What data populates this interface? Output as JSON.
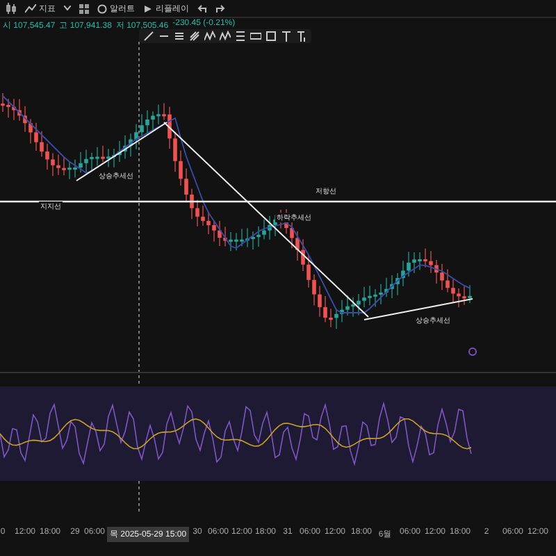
{
  "toolbar": {
    "items": [
      {
        "kind": "indicator",
        "label": "지표"
      },
      {
        "kind": "alert",
        "label": "알러트"
      },
      {
        "kind": "replay",
        "label": "리플레이"
      }
    ]
  },
  "ohlc": [
    {
      "label": "시",
      "value": "107,545.47"
    },
    {
      "label": "고",
      "value": "107,941.38"
    },
    {
      "label": "저",
      "value": "107,505.46"
    },
    {
      "value": "-230.45 (-0.21%)"
    }
  ],
  "annotations": [
    {
      "text": "지지선"
    },
    {
      "text": "상승추세선"
    },
    {
      "text": "하락추세선"
    },
    {
      "text": "저항선"
    },
    {
      "text": "상승추세선"
    }
  ],
  "time_axis": {
    "labels": [
      "0",
      "12:00",
      "18:00",
      "29",
      "06:00",
      "30",
      "06:00",
      "12:00",
      "18:00",
      "31",
      "06:00",
      "12:00",
      "18:00",
      "6월",
      "06:00",
      "12:00",
      "18:00",
      "2",
      "06:00",
      "12:00"
    ],
    "crosshair_label": "목 2025-05-29  15:00"
  }
}
